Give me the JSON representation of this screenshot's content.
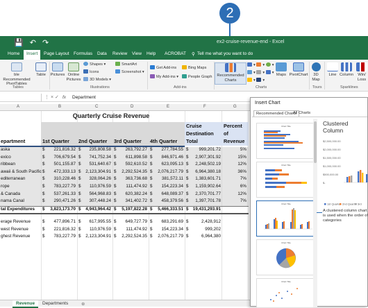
{
  "callout": {
    "number": "2"
  },
  "titlebar": {
    "title": "ex2-cruise-revenue-end - Excel"
  },
  "ribbon_tabs": [
    {
      "label": "Home"
    },
    {
      "label": "Insert"
    },
    {
      "label": "Page Layout"
    },
    {
      "label": "Formulas"
    },
    {
      "label": "Data"
    },
    {
      "label": "Review"
    },
    {
      "label": "View"
    },
    {
      "label": "Help"
    },
    {
      "label": "ACROBAT"
    },
    {
      "label": "Tell me what you want to do"
    }
  ],
  "ribbon": {
    "tables": {
      "rec_pivot": "ble Recommended PivotTables",
      "table": "Table",
      "group": "Tables"
    },
    "illustrations": {
      "pictures": "Pictures",
      "online_pictures": "Online Pictures",
      "shapes": "Shapes",
      "icons": "Icons",
      "models": "3D Models",
      "smartart": "SmartArt",
      "screenshot": "Screenshot",
      "group": "Illustrations"
    },
    "addins": {
      "get": "Get Add-ins",
      "my": "My Add-ins",
      "bing": "Bing Maps",
      "people": "People Graph",
      "group": "Add-ins"
    },
    "charts": {
      "recommended": "Recommended Charts",
      "maps": "Maps",
      "pivotchart": "PivotChart",
      "group": "Charts"
    },
    "tours": {
      "map3d": "3D Map",
      "group": "Tours"
    },
    "sparklines": {
      "line": "Line",
      "column": "Column",
      "winloss": "Win/ Loss",
      "group": "Sparklines"
    }
  },
  "formula_bar": {
    "fx": "fx",
    "value": "Department"
  },
  "columns": [
    "A",
    "B",
    "C",
    "D",
    "E",
    "F",
    "G"
  ],
  "sheet": {
    "title": "Quarterly Cruise Revenue",
    "headers": {
      "department": "epartment",
      "q1": "1st Quarter",
      "q2": "2nd Quarter",
      "q3": "3rd Quarter",
      "q4": "4th Quarter",
      "total1": "Cruise",
      "total2": "Destination",
      "total3": "Total",
      "pct1": "Percent",
      "pct2": "of",
      "pct3": "Revenue"
    },
    "rows": [
      {
        "dept": "aska",
        "q1": "221,816.32",
        "q2": "235,808.58",
        "q3": "263,792.27",
        "q4": "277,784.55",
        "total": "999,201.72",
        "pct": "5%"
      },
      {
        "dept": "exico",
        "q1": "706,679.54",
        "q2": "741,752.34",
        "q3": "611,898.58",
        "q4": "846,971.46",
        "total": "2,907,301.92",
        "pct": "15%"
      },
      {
        "dept": "ribbean",
        "q1": "501,155.87",
        "q2": "531,640.67",
        "q3": "592,610.52",
        "q4": "623,095.13",
        "total": "2,248,502.19",
        "pct": "12%"
      },
      {
        "dept": "awaii & South Pacific",
        "q1": "472,333.13",
        "q2": "2,123,304.91",
        "q3": "2,292,524.35",
        "q4": "2,076,217.79",
        "total": "6,964,380.18",
        "pct": "36%"
      },
      {
        "dept": "editerranean",
        "q1": "310,228.46",
        "q2": "328,064.26",
        "q3": "363,736.68",
        "q4": "381,572.11",
        "total": "1,383,601.71",
        "pct": "7%"
      },
      {
        "dept": "rope",
        "q1": "783,227.79",
        "q2": "110,976.59",
        "q3": "111,474.92",
        "q4": "154,223.34",
        "total": "1,159,902.64",
        "pct": "6%"
      },
      {
        "dept": "& Canada",
        "q1": "537,261.33",
        "q2": "564,968.83",
        "q3": "620,382.24",
        "q4": "648,089.37",
        "total": "2,370,701.77",
        "pct": "12%"
      },
      {
        "dept": "nama Canal",
        "q1": "290,471.26",
        "q2": "307,448.24",
        "q3": "341,402.72",
        "q4": "458,379.56",
        "total": "1,397,701.78",
        "pct": "7%"
      }
    ],
    "total_row": {
      "dept": "tal Expenditures",
      "q1": "3,823,173.70",
      "q2": "4,943,964.42",
      "q3": "5,197,822.28",
      "q4": "5,466,333.51",
      "total": "19,431,293.91"
    },
    "stats": [
      {
        "label": "erage Revenue",
        "q1": "477,896.71",
        "q2": "617,995.55",
        "q3": "649,727.79",
        "q4": "683,291.69",
        "total": "2,428,912"
      },
      {
        "label": "west Revenue",
        "q1": "221,816.32",
        "q2": "110,976.59",
        "q3": "111,474.92",
        "q4": "154,223.34",
        "total": "999,202"
      },
      {
        "label": "ghest Revenue",
        "q1": "783,227.79",
        "q2": "2,123,304.91",
        "q3": "2,292,524.35",
        "q4": "2,076,217.79",
        "total": "6,964,380"
      }
    ],
    "dollar": "$"
  },
  "sheet_tabs": [
    {
      "label": "Revenue"
    },
    {
      "label": "Departments"
    }
  ],
  "dialog": {
    "title": "Insert Chart",
    "tabs": [
      {
        "label": "Recommended Charts"
      },
      {
        "label": "All Charts"
      }
    ],
    "thumb_title": "Chart Title",
    "preview_title": "Clustered Column",
    "y_ticks": [
      "$2,500,000.00",
      "$2,000,000.00",
      "$1,500,000.00",
      "$1,000,000.00",
      "$500,000.00",
      "$-"
    ],
    "legend": [
      "1st Quarter",
      "2nd Quarter",
      "3rd"
    ],
    "description": "A clustered column chart is used when the order of categories"
  },
  "colors": {
    "excel_green": "#217346",
    "accent_blue": "#2d6eb5",
    "q1": "#4472c4",
    "q2": "#ed7d31",
    "q3": "#a5a5a5",
    "q4": "#ffc000"
  }
}
